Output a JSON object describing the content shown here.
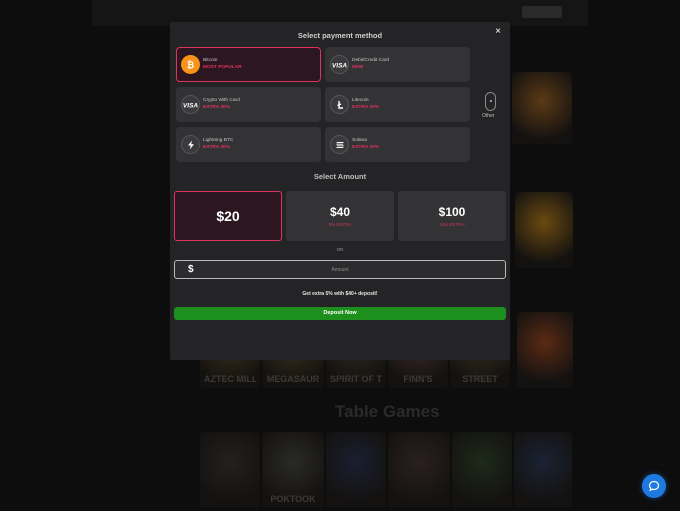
{
  "colors": {
    "accent": "#e0325e",
    "deposit": "#1c8f1c",
    "modal_bg": "#242426",
    "card_bg": "#333335",
    "chat": "#1e7ae0"
  },
  "background": {
    "tiles": [
      {
        "label": "",
        "glow": "#5b3a16"
      },
      {
        "label": "",
        "glow": "#6a4a10"
      },
      {
        "label": "",
        "glow": "#5a2a14"
      },
      {
        "label": "AZTEC MILLIONS",
        "glow": "#3a2f1a"
      },
      {
        "label": "MEGASAUR",
        "glow": "#3a321c"
      },
      {
        "label": "SPIRIT OF THE INCA",
        "glow": "#2f2a22"
      },
      {
        "label": "FINN'S",
        "glow": "#3a2a2a"
      },
      {
        "label": "STREET",
        "glow": "#352a1e"
      },
      {
        "label": "",
        "glow": "#3a2a1a"
      },
      {
        "label": "",
        "glow": "#232020"
      },
      {
        "label": "POKTOOK",
        "glow": "#2a2a26"
      },
      {
        "label": "",
        "glow": "#1a1f30"
      },
      {
        "label": "",
        "glow": "#2a2020"
      },
      {
        "label": "",
        "glow": "#1d2a1a"
      },
      {
        "label": "",
        "glow": "#1a2233"
      }
    ],
    "section_heading": "Table Games"
  },
  "modal": {
    "title": "Select payment method",
    "close_glyph": "×",
    "payment_methods": [
      {
        "name": "Bitcoin",
        "tag": "MOST POPULAR",
        "icon": "bitcoin-icon",
        "icon_bg": "#f7931a",
        "selected": true
      },
      {
        "name": "Debit/Credit Card",
        "tag": "NEW",
        "icon": "visa-icon",
        "icon_bg": "#3a3a3c",
        "selected": false
      },
      {
        "name": "Crypto With Card",
        "tag": "EXTRA 30%",
        "icon": "visa-icon",
        "icon_bg": "#3a3a3c",
        "selected": false
      },
      {
        "name": "Litecoin",
        "tag": "EXTRA 30%",
        "icon": "litecoin-icon",
        "icon_bg": "#3a3a3c",
        "selected": false
      },
      {
        "name": "Lightning BTC",
        "tag": "EXTRA 30%",
        "icon": "lightning-icon",
        "icon_bg": "#3a3a3c",
        "selected": false
      },
      {
        "name": "Solana",
        "tag": "EXTRA 30%",
        "icon": "solana-icon",
        "icon_bg": "#3a3a3c",
        "selected": false
      }
    ],
    "other_label": "Other",
    "amount_title": "Select Amount",
    "amounts": [
      {
        "value": "$20",
        "extra": "",
        "selected": true
      },
      {
        "value": "$40",
        "extra": "5% EXTRA",
        "selected": false
      },
      {
        "value": "$100",
        "extra": "10% EXTRA",
        "selected": false
      }
    ],
    "or_label": "OR",
    "amount_input": {
      "currency": "$",
      "placeholder": "Amount",
      "value": ""
    },
    "promo": "Get extra 5% with $40+ deposit!",
    "deposit_label": "Deposit Now"
  }
}
